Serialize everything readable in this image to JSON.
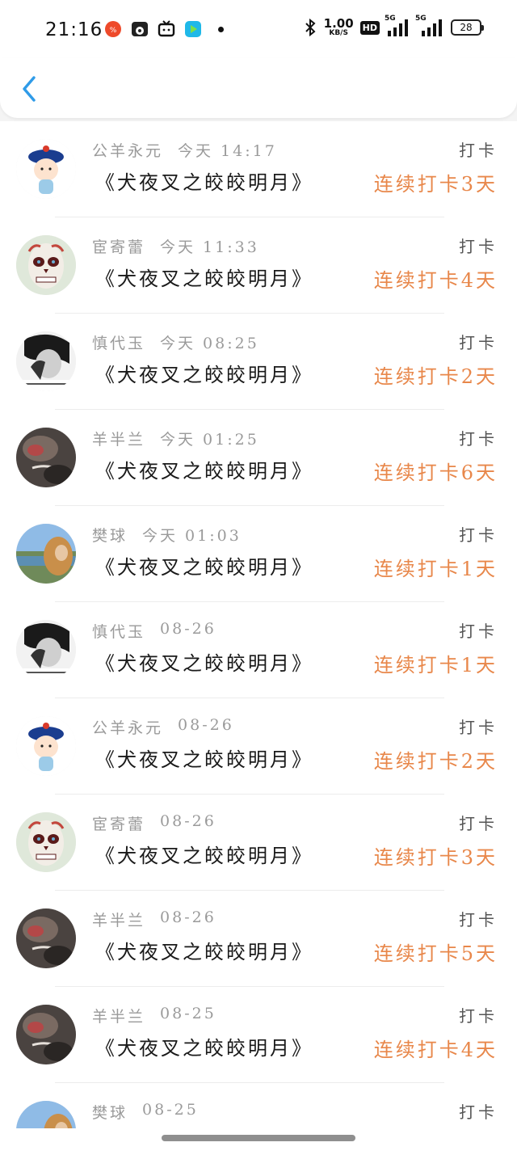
{
  "status_bar": {
    "time": "21:16",
    "net_speed_value": "1.00",
    "net_speed_unit": "KB/S",
    "hd_label": "HD",
    "signal1_label": "5G",
    "signal2_label": "5G",
    "battery": "28"
  },
  "header": {
    "back_icon": "chevron-left-icon",
    "accent": "#2f9be8"
  },
  "colors": {
    "streak": "#e8874a",
    "meta": "#9a9a9a",
    "title": "#1a1a1a"
  },
  "entries": [
    {
      "name": "公羊永元",
      "time": "今天 14:17",
      "book": "《犬夜叉之皎皎明月》",
      "action": "打卡",
      "streak": "连续打卡3天",
      "avatar": "qing-official-avatar"
    },
    {
      "name": "宦寄蕾",
      "time": "今天 11:33",
      "book": "《犬夜叉之皎皎明月》",
      "action": "打卡",
      "streak": "连续打卡4天",
      "avatar": "skull-face-avatar"
    },
    {
      "name": "慎代玉",
      "time": "今天 08:25",
      "book": "《犬夜叉之皎皎明月》",
      "action": "打卡",
      "streak": "连续打卡2天",
      "avatar": "bw-photo-avatar"
    },
    {
      "name": "羊半兰",
      "time": "今天 01:25",
      "book": "《犬夜叉之皎皎明月》",
      "action": "打卡",
      "streak": "连续打卡6天",
      "avatar": "dark-closeup-avatar"
    },
    {
      "name": "樊球",
      "time": "今天 01:03",
      "book": "《犬夜叉之皎皎明月》",
      "action": "打卡",
      "streak": "连续打卡1天",
      "avatar": "landscape-avatar"
    },
    {
      "name": "慎代玉",
      "time": "08-26",
      "book": "《犬夜叉之皎皎明月》",
      "action": "打卡",
      "streak": "连续打卡1天",
      "avatar": "bw-photo-avatar"
    },
    {
      "name": "公羊永元",
      "time": "08-26",
      "book": "《犬夜叉之皎皎明月》",
      "action": "打卡",
      "streak": "连续打卡2天",
      "avatar": "qing-official-avatar"
    },
    {
      "name": "宦寄蕾",
      "time": "08-26",
      "book": "《犬夜叉之皎皎明月》",
      "action": "打卡",
      "streak": "连续打卡3天",
      "avatar": "skull-face-avatar"
    },
    {
      "name": "羊半兰",
      "time": "08-26",
      "book": "《犬夜叉之皎皎明月》",
      "action": "打卡",
      "streak": "连续打卡5天",
      "avatar": "dark-closeup-avatar"
    },
    {
      "name": "羊半兰",
      "time": "08-25",
      "book": "《犬夜叉之皎皎明月》",
      "action": "打卡",
      "streak": "连续打卡4天",
      "avatar": "dark-closeup-avatar"
    },
    {
      "name": "樊球",
      "time": "08-25",
      "book": "",
      "action": "打卡",
      "streak": "",
      "avatar": "landscape-avatar"
    }
  ]
}
